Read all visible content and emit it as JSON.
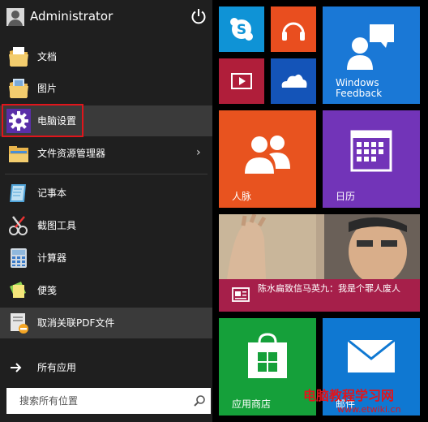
{
  "user": {
    "name": "Administrator"
  },
  "menu": [
    {
      "label": "文档"
    },
    {
      "label": "图片"
    },
    {
      "label": "电脑设置"
    },
    {
      "label": "文件资源管理器"
    },
    {
      "label": "记事本"
    },
    {
      "label": "截图工具"
    },
    {
      "label": "计算器"
    },
    {
      "label": "便笺"
    },
    {
      "label": "取消关联PDF文件"
    }
  ],
  "all_apps": {
    "label": "所有应用"
  },
  "search": {
    "placeholder": "搜索所有位置"
  },
  "tiles": {
    "skype": {
      "icon": "skype-icon"
    },
    "music": {
      "icon": "headphones-icon"
    },
    "windows_feedback": {
      "label_line1": "Windows",
      "label_line2": "Feedback"
    },
    "video": {
      "icon": "video-icon"
    },
    "onedrive": {
      "icon": "cloud-icon"
    },
    "people": {
      "label": "人脉"
    },
    "calendar": {
      "label": "日历"
    },
    "news": {
      "title": "陈水扁致信马英九：我是个罪人废人"
    },
    "store": {
      "label": "应用商店"
    },
    "mail": {
      "label": "邮件"
    }
  },
  "watermark": {
    "text": "电脑教程学习网",
    "url": "www.etwiki.cn"
  },
  "colors": {
    "skype_blue": "#0f93d6",
    "music_orange": "#e94e1f",
    "feedback_blue": "#1a78d6",
    "video_crimson": "#b01e3a",
    "onedrive_blue": "#1454b8",
    "people_orange": "#e8531f",
    "calendar_purple": "#7234b8",
    "news_crimson": "#a61f4a",
    "store_green": "#15a03a",
    "mail_blue": "#0f78d2"
  }
}
